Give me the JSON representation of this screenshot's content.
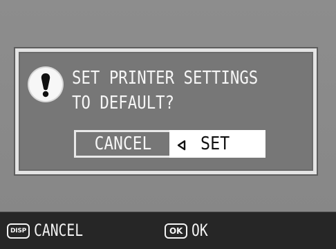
{
  "dialog": {
    "message_lines": [
      "SET PRINTER SETTINGS",
      "TO DEFAULT?"
    ],
    "cancel_label": "CANCEL",
    "set_label": "SET",
    "alert_icon": "exclamation-icon",
    "selector_icon": "left-pointer-icon"
  },
  "footer": {
    "disp_key": "DISP",
    "cancel_label": "CANCEL",
    "ok_key": "OK",
    "ok_label": "OK"
  },
  "colors": {
    "background": "#888888",
    "dialog": "#777777",
    "footer": "#262626",
    "selected": "#ffffff",
    "text": "#f6f6f6"
  }
}
